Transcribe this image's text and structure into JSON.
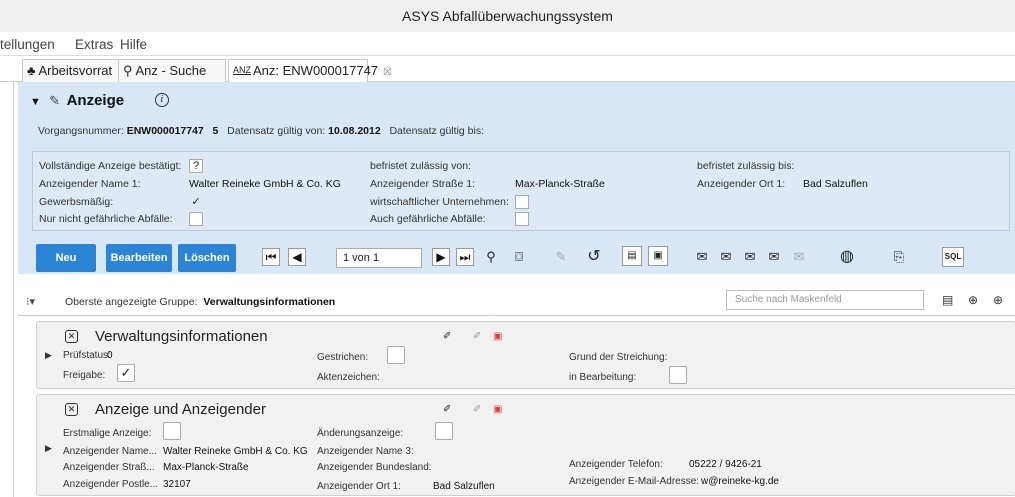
{
  "window": {
    "title": "ASYS Abfallüberwachungssystem"
  },
  "menu": {
    "items": [
      "tellungen",
      "Extras",
      "Hilfe"
    ]
  },
  "tabs": [
    {
      "icon": "person-icon",
      "label": "Arbeitsvorrat"
    },
    {
      "icon": "search-icon",
      "label": "Anz - Suche"
    },
    {
      "prefix": "ANZ",
      "label": "Anz: ENW000017747",
      "close": "☒"
    }
  ],
  "anzeige": {
    "title": "Anzeige",
    "vorgang_label": "Vorgangsnummer:",
    "vorgang_value": "ENW000017747",
    "vorgang_count": "5",
    "gueltig_von_label": "Datensatz gültig von:",
    "gueltig_von_value": "10.08.2012",
    "gueltig_bis_label": "Datensatz gültig bis:",
    "fields": {
      "bestaetigt_label": "Vollständige Anzeige bestätigt:",
      "bestaetigt_value": "?",
      "name_label": "Anzeigender Name 1:",
      "name_value": "Walter Reineke GmbH & Co. KG",
      "gewerbs_label": "Gewerbsmäßig:",
      "gewerbs_value": "✓",
      "nurnicht_label": "Nur nicht gefährliche Abfälle:",
      "befristet_von_label": "befristet zulässig von:",
      "strasse_label": "Anzeigender Straße 1:",
      "strasse_value": "Max-Planck-Straße",
      "wirtschaft_label": "wirtschaftlicher Unternehmen:",
      "auch_label": "Auch gefährliche Abfälle:",
      "befristet_bis_label": "befristet zulässig bis:",
      "ort_label": "Anzeigender Ort 1:",
      "ort_value": "Bad Salzuflen"
    }
  },
  "buttons": {
    "neu": "Neu",
    "bearbeiten": "Bearbeiten",
    "loeschen": "Löschen"
  },
  "pager": {
    "value": "1 von 1"
  },
  "toolbar": {
    "sql": "SQL"
  },
  "group": {
    "label": "Oberste angezeigte Gruppe:",
    "value": "Verwaltungsinformationen",
    "search_placeholder": "Suche nach Maskenfeld"
  },
  "sections": {
    "verwaltung": {
      "title": "Verwaltungsinformationen",
      "pruefstatus_label": "Prüfstatus:",
      "pruefstatus_value": "0",
      "freigabe_label": "Freigabe:",
      "freigabe_value": "✓",
      "gestrichen_label": "Gestrichen:",
      "aktenzeichen_label": "Aktenzeichen:",
      "grund_label": "Grund der Streichung:",
      "inbearb_label": "in Bearbeitung:"
    },
    "anzeigender": {
      "title": "Anzeige und Anzeigender",
      "erstmalig_label": "Erstmalige Anzeige:",
      "name_label": "Anzeigender Name...",
      "name_value": "Walter Reineke GmbH & Co. KG",
      "strasse_label": "Anzeigender Straß...",
      "strasse_value": "Max-Planck-Straße",
      "postleitzahl_label": "Anzeigender Postle...",
      "postleitzahl_value": "32107",
      "aenderung_label": "Änderungsanzeige:",
      "name3_label": "Anzeigender Name 3:",
      "bundesland_label": "Anzeigender Bundesland:",
      "ort_label": "Anzeigender Ort 1:",
      "ort_value": "Bad Salzuflen",
      "telefon_label": "Anzeigender Telefon:",
      "telefon_value": "05222 / 9426-21",
      "email_label": "Anzeigender E-Mail-Adresse:",
      "email_value": "w@reineke-kg.de"
    }
  },
  "colors": {
    "accent": "#2b84d6",
    "panel": "#d8e7f6"
  }
}
